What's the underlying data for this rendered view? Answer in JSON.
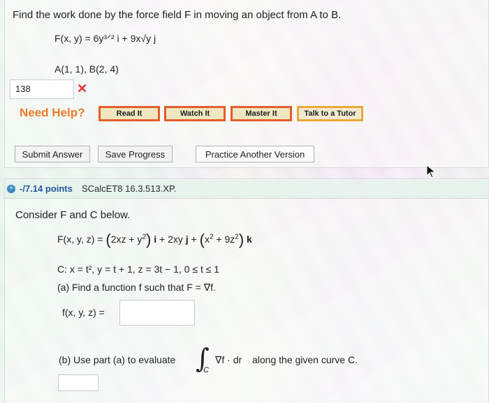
{
  "problem1": {
    "prompt": "Find the work done by the force field F in moving an object from A to B.",
    "force_field": "F(x, y) = 6y³ᐟ² i + 9x√y j",
    "points": "A(1, 1),   B(2, 4)",
    "answer_value": "138",
    "answer_status": "✕"
  },
  "help": {
    "label": "Need Help?",
    "read_it": "Read It",
    "watch_it": "Watch It",
    "master_it": "Master It",
    "talk_to_tutor": "Talk to a Tutor"
  },
  "actions": {
    "submit": "Submit Answer",
    "save": "Save Progress",
    "practice": "Practice Another Version"
  },
  "problem2": {
    "points_label": "-/7.14 points",
    "course_code": "SCalcET8 16.3.513.XP.",
    "intro": "Consider F and C below.",
    "force_field_prefix": "F(x, y, z) =",
    "curve": "C: x = t², y = t + 1, z = 3t − 1, 0 ≤ t ≤ 1",
    "part_a": "(a) Find a function f such that F = ∇f.",
    "f_label": "f(x, y, z) =",
    "f_value": "",
    "part_b_prefix": "(b) Use part (a) to evaluate",
    "part_b_integrand": "∇f · dr",
    "part_b_suffix": "along the given curve C.",
    "part_b_value": ""
  },
  "colors": {
    "need_help": "#ef7a28",
    "button_border": "#e35c2a",
    "points_blue": "#2656a0",
    "error_red": "#e0302b"
  }
}
